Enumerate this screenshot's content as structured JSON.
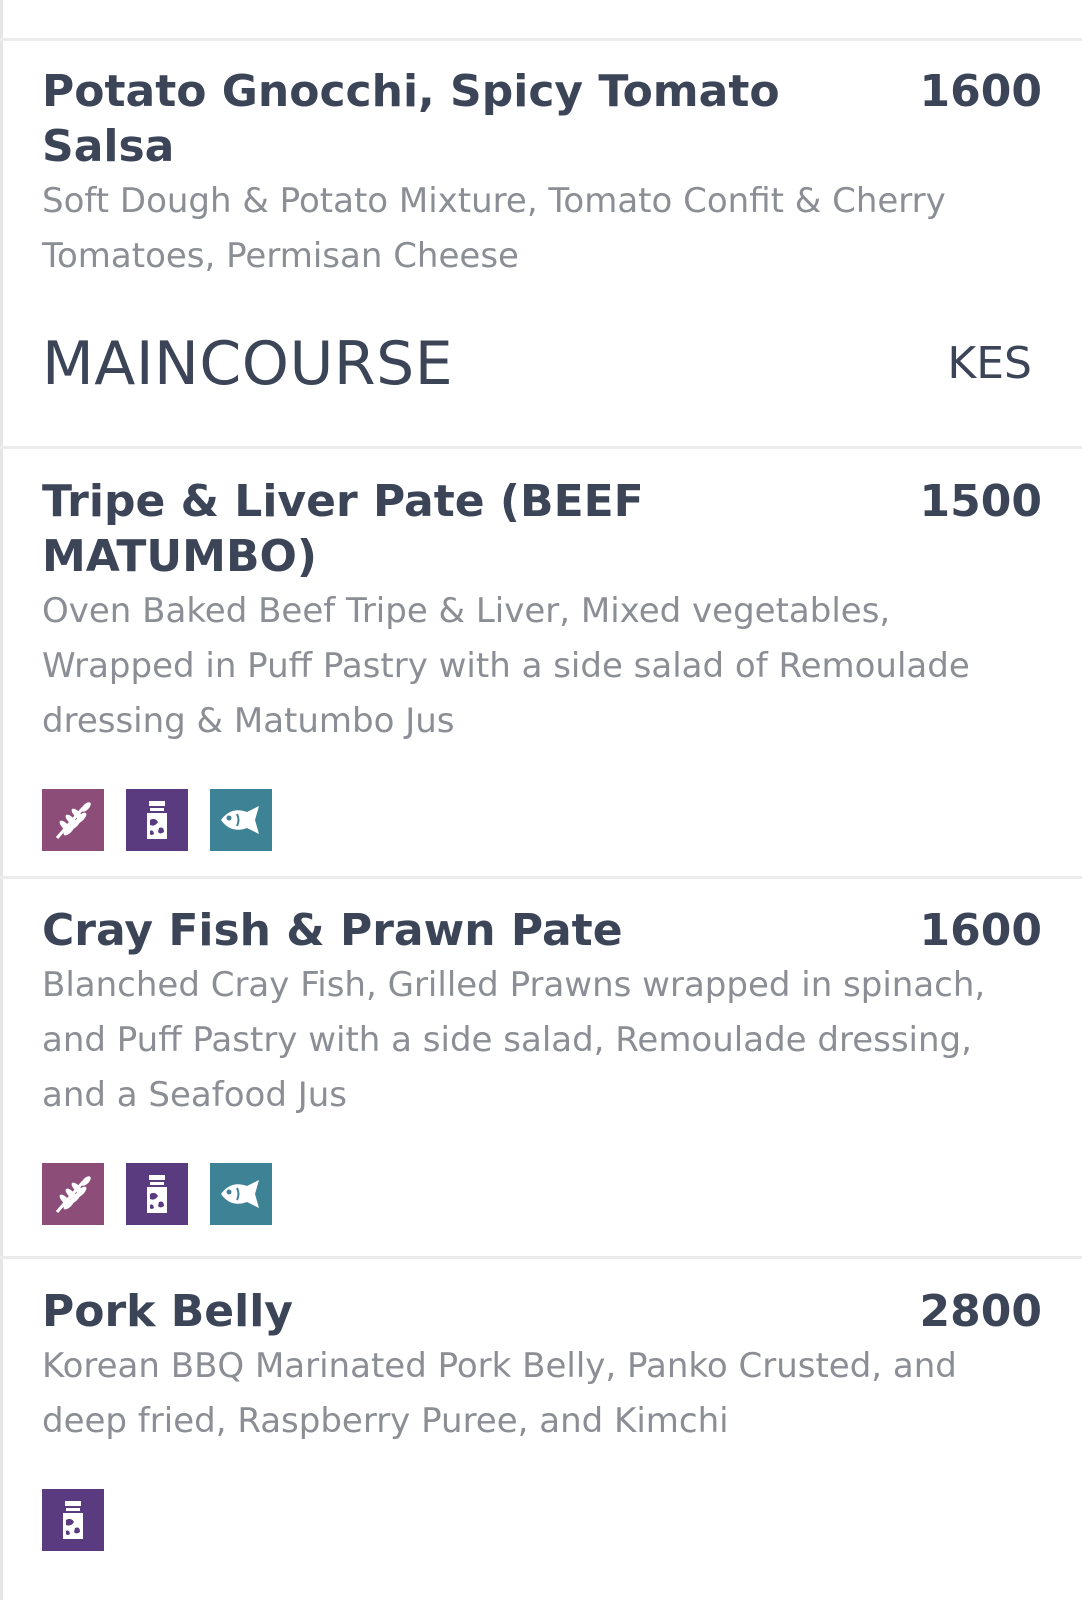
{
  "items_top": [
    {
      "name": "Potato Gnocchi, Spicy Tomato Salsa",
      "price": "1600",
      "description": "Soft Dough & Potato Mixture, Tomato Confit & Cherry Tomatoes, Permisan Cheese"
    }
  ],
  "section": {
    "title": "MAINCOURSE",
    "currency": "KES"
  },
  "items": [
    {
      "name": "Tripe & Liver Pate (BEEF MATUMBO)",
      "price": "1500",
      "description": "Oven Baked Beef Tripe & Liver, Mixed vegetables, Wrapped in Puff Pastry with a side salad of Remoulade dressing & Matumbo Jus",
      "allergens": [
        "gluten-icon",
        "dairy-icon",
        "fish-icon"
      ]
    },
    {
      "name": "Cray Fish & Prawn Pate",
      "price": "1600",
      "description": "Blanched Cray Fish, Grilled Prawns wrapped in spinach, and Puff Pastry with a side salad, Remoulade dressing, and a Seafood Jus",
      "allergens": [
        "gluten-icon",
        "dairy-icon",
        "fish-icon"
      ]
    },
    {
      "name": "Pork Belly",
      "price": "2800",
      "description": "Korean BBQ Marinated Pork Belly, Panko Crusted, and deep fried, Raspberry Puree, and Kimchi",
      "allergens": [
        "dairy-icon"
      ]
    }
  ],
  "colors": {
    "gluten": "#8c4d78",
    "dairy": "#5b3b80",
    "fish": "#3e8296",
    "text_dark": "#3b4557",
    "text_muted": "#8b8e94"
  }
}
